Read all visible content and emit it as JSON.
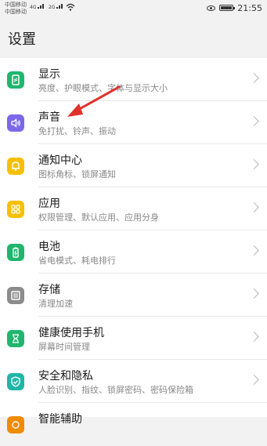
{
  "status_bar": {
    "carrier1": "中国移动",
    "carrier2": "中国移动",
    "signal1": "4G",
    "signal2": "2G",
    "time": "21:55",
    "battery_level": 0.95
  },
  "page": {
    "title": "设置"
  },
  "items": [
    {
      "label": "显示",
      "sub": "亮度、护眼模式、字体与显示大小",
      "color": "#1fb66e",
      "icon": "display-icon"
    },
    {
      "label": "声音",
      "sub": "免打扰、铃声、振动",
      "color": "#7b67e8",
      "icon": "sound-icon"
    },
    {
      "label": "通知中心",
      "sub": "图标角标、锁屏通知",
      "color": "#f6c000",
      "icon": "bell-icon"
    },
    {
      "label": "应用",
      "sub": "权限管理、默认应用、应用分身",
      "color": "#f6c000",
      "icon": "apps-icon"
    },
    {
      "label": "电池",
      "sub": "省电模式、耗电排行",
      "color": "#1fb66e",
      "icon": "battery-icon"
    },
    {
      "label": "存储",
      "sub": "清理加速",
      "color": "#8c8c8c",
      "icon": "storage-icon"
    },
    {
      "label": "健康使用手机",
      "sub": "屏幕时间管理",
      "color": "#1fb66e",
      "icon": "hourglass-icon"
    },
    {
      "label": "安全和隐私",
      "sub": "人脸识别、指纹、锁屏密码、密码保险箱",
      "color": "#1fb6a8",
      "icon": "shield-icon"
    },
    {
      "label": "智能辅助",
      "sub": "",
      "color": "#f08a00",
      "icon": "assist-icon"
    }
  ],
  "accent": {
    "annotation_arrow": "#e0302a"
  }
}
